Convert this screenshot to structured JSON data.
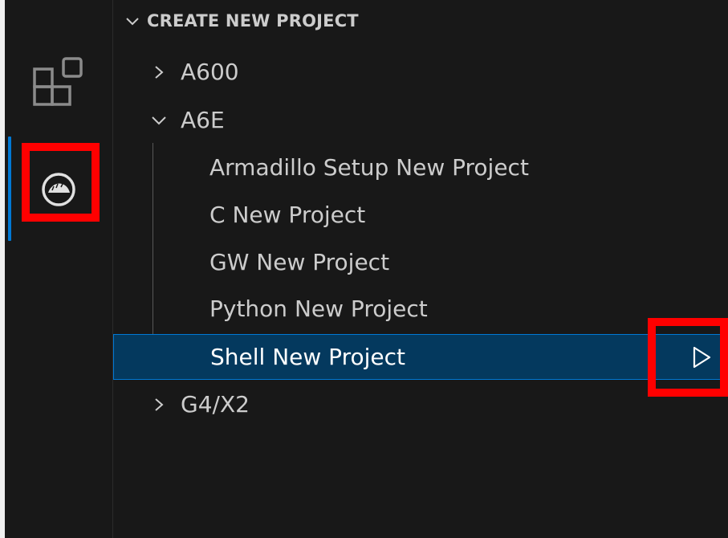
{
  "activity_bar": {
    "items": [
      {
        "icon": "extensions-icon"
      },
      {
        "icon": "armadillo-icon",
        "active": true
      }
    ]
  },
  "sidebar": {
    "section_title": "CREATE NEW PROJECT",
    "tree": [
      {
        "label": "A600",
        "expanded": false
      },
      {
        "label": "A6E",
        "expanded": true,
        "children": [
          {
            "label": "Armadillo Setup New Project"
          },
          {
            "label": "C New Project"
          },
          {
            "label": "GW New Project"
          },
          {
            "label": "Python New Project"
          },
          {
            "label": "Shell New Project",
            "selected": true,
            "action_icon": "play-icon"
          }
        ]
      },
      {
        "label": "G4/X2",
        "expanded": false
      }
    ]
  },
  "colors": {
    "background": "#181818",
    "selection_bg": "#04395e",
    "selection_border": "#0078d4",
    "highlight_box": "#ff0000",
    "text": "#cccccc"
  }
}
